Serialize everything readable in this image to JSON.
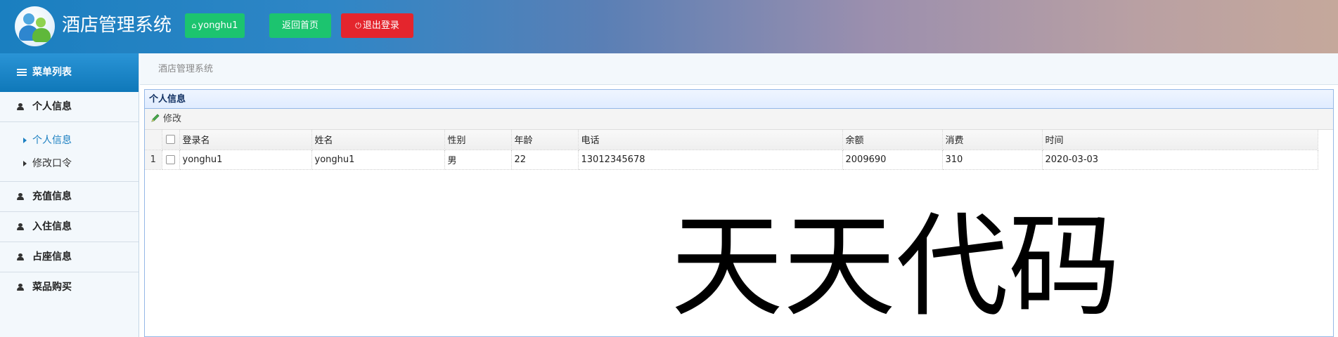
{
  "header": {
    "title": "酒店管理系统",
    "user_button": "yonghu1",
    "home_button": "返回首页",
    "logout_button": "退出登录"
  },
  "sidebar": {
    "heading": "菜单列表",
    "groups": [
      {
        "label": "个人信息",
        "items": [
          {
            "label": "个人信息",
            "active": true
          },
          {
            "label": "修改口令",
            "active": false
          }
        ]
      },
      {
        "label": "充值信息"
      },
      {
        "label": "入住信息"
      },
      {
        "label": "占座信息"
      },
      {
        "label": "菜品购买"
      }
    ]
  },
  "breadcrumb": "酒店管理系统",
  "panel": {
    "title": "个人信息",
    "toolbar": {
      "edit_label": "修改"
    },
    "columns": [
      "登录名",
      "姓名",
      "性别",
      "年龄",
      "电话",
      "余额",
      "消费",
      "时间"
    ],
    "rows": [
      {
        "num": "1",
        "cells": [
          "yonghu1",
          "yonghu1",
          "男",
          "22",
          "13012345678",
          "2009690",
          "310",
          "2020-03-03"
        ]
      }
    ]
  },
  "watermark": "天天代码",
  "colors": {
    "header_start": "#1a7fc0",
    "green": "#1cc46f",
    "red": "#e4252d",
    "accent": "#1b7fc1"
  }
}
